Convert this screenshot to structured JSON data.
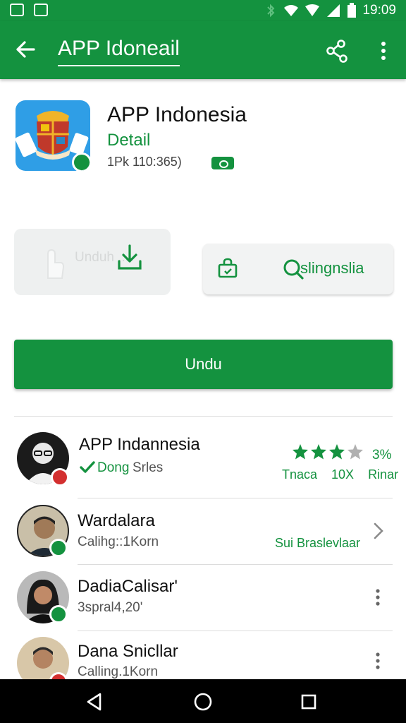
{
  "status_bar": {
    "time": "19:09"
  },
  "app_bar": {
    "title": "APP Idoneail"
  },
  "app": {
    "name": "APP Indonesia",
    "subtitle": "Detail",
    "meta": "1Pk  110:365)"
  },
  "actions": {
    "ghost_label": "Unduh ...",
    "search_label": "slingnslia",
    "primary_label": "Undu"
  },
  "rows": [
    {
      "name": "APP Indannesia",
      "status": "Dong",
      "sub": "Srles",
      "rating": 3,
      "rating_value": "3%",
      "rating_meta": [
        "Tnaca",
        "10X",
        "Rinar"
      ]
    },
    {
      "name": "Wardalara",
      "sub": "Calihg::1Korn",
      "right_label": "Sui Braslevlaar"
    },
    {
      "name": "DadiaCalisar'",
      "sub": "3spral4,20'"
    },
    {
      "name": "Dana Snicllar",
      "sub": "Calling.1Korn"
    }
  ],
  "colors": {
    "accent": "#14923f",
    "badge_red": "#d32f2f",
    "star_off": "#b0b0b0"
  },
  "icons": [
    "back-arrow-icon",
    "share-icon",
    "more-vert-icon",
    "download-icon",
    "bag-icon",
    "search-icon",
    "chevron-right-icon",
    "check-icon",
    "star-icon",
    "nav-back-icon",
    "nav-home-icon",
    "nav-recents-icon"
  ]
}
